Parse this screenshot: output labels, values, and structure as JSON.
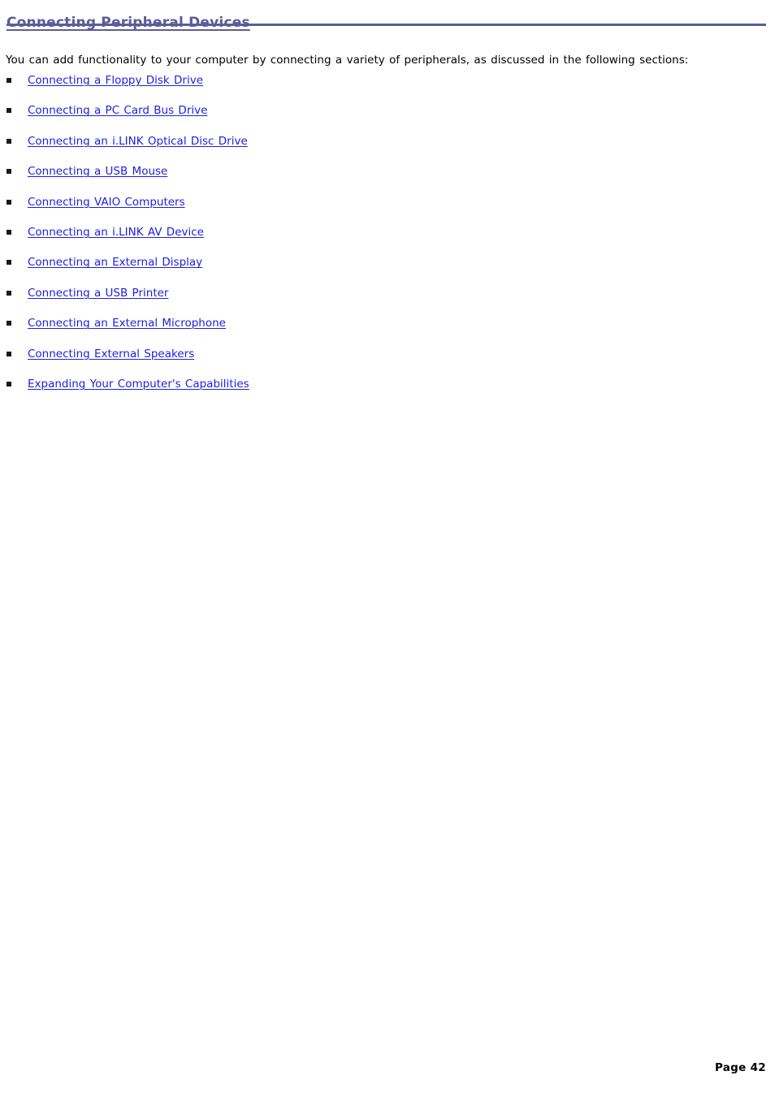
{
  "document": {
    "heading": "Connecting Peripheral Devices",
    "intro": "You can add functionality to your computer by connecting a variety of peripherals, as discussed in the following sections:",
    "links": [
      {
        "label": "Connecting a Floppy Disk Drive"
      },
      {
        "label": "Connecting a PC Card Bus Drive"
      },
      {
        "label": "Connecting an i.LINK Optical Disc Drive"
      },
      {
        "label": "Connecting a USB Mouse"
      },
      {
        "label": "Connecting VAIO Computers"
      },
      {
        "label": "Connecting an i.LINK AV Device"
      },
      {
        "label": "Connecting an External Display"
      },
      {
        "label": "Connecting a USB Printer"
      },
      {
        "label": "Connecting an External Microphone"
      },
      {
        "label": "Connecting External Speakers"
      },
      {
        "label": "Expanding Your Computer's Capabilities"
      }
    ],
    "footer": {
      "page_label": "Page 42"
    },
    "colors": {
      "heading": "#5c5c99",
      "rule": "#5c5c99",
      "link": "#2020e0",
      "bullet": "#1a1a1a",
      "body_text": "#000000",
      "background": "#ffffff"
    },
    "icons": {
      "bullet": "bullet-square-icon"
    }
  }
}
